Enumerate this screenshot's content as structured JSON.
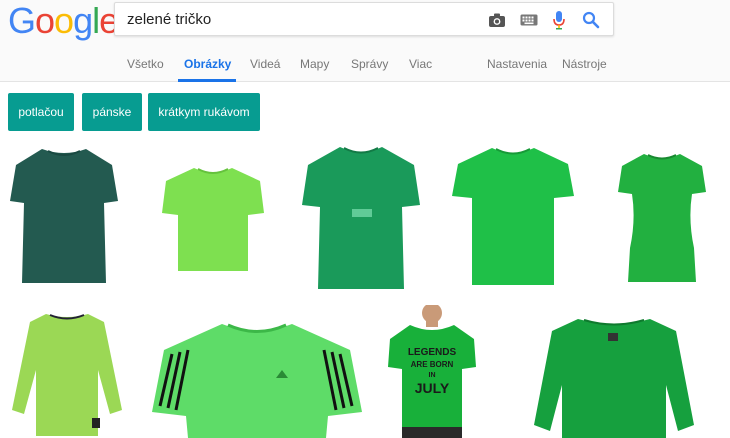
{
  "logo": {
    "letters": [
      "G",
      "o",
      "o",
      "g",
      "l",
      "e"
    ],
    "colors": [
      "#4285f4",
      "#ea4335",
      "#fbbc05",
      "#4285f4",
      "#34a853",
      "#ea4335"
    ]
  },
  "search": {
    "query": "zelené tričko",
    "icons": [
      "camera-icon",
      "keyboard-icon",
      "microphone-icon",
      "search-icon"
    ]
  },
  "tabs": [
    {
      "label": "Všetko",
      "active": false
    },
    {
      "label": "Obrázky",
      "active": true
    },
    {
      "label": "Videá",
      "active": false
    },
    {
      "label": "Mapy",
      "active": false
    },
    {
      "label": "Správy",
      "active": false
    },
    {
      "label": "Viac",
      "active": false
    }
  ],
  "tools": [
    {
      "label": "Nastavenia"
    },
    {
      "label": "Nástroje"
    }
  ],
  "chips": [
    {
      "label": "potlačou"
    },
    {
      "label": "pánske"
    },
    {
      "label": "krátkym rukávom"
    }
  ],
  "results": [
    {
      "kind": "tshirt",
      "color": "#235a50"
    },
    {
      "kind": "tshirt",
      "color": "#7ee050"
    },
    {
      "kind": "tshirt",
      "color": "#1a9a5a",
      "print": "printed"
    },
    {
      "kind": "tshirt",
      "color": "#1fc048"
    },
    {
      "kind": "tshirt-women",
      "color": "#22b040"
    },
    {
      "kind": "longsleeve",
      "color": "#9bd855"
    },
    {
      "kind": "sport-tshirt",
      "color": "#5edc68"
    },
    {
      "kind": "model-tshirt",
      "color": "#18b03a",
      "print_text": [
        "LEGENDS",
        "ARE BORN",
        "IN",
        "JULY"
      ]
    },
    {
      "kind": "longsleeve-women",
      "color": "#16a03e"
    }
  ],
  "colors": {
    "accent": "#1a73e8",
    "chip": "#079c91"
  }
}
